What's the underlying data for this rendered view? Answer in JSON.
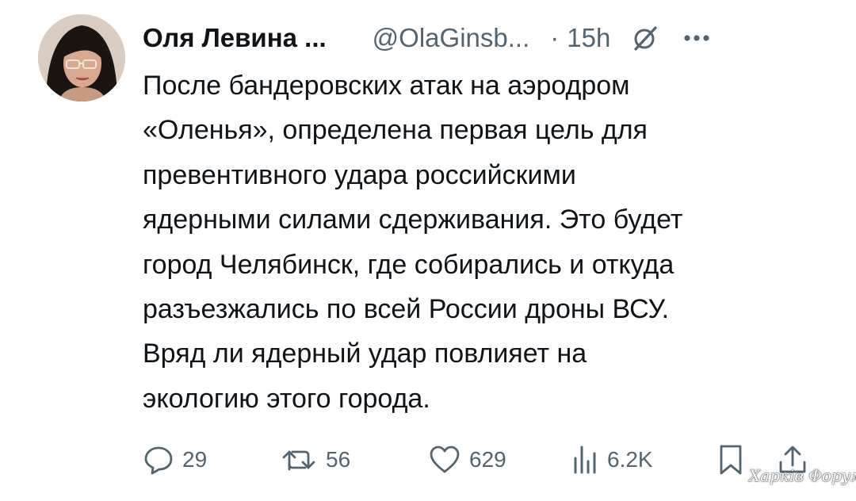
{
  "author": {
    "name": "Оля Левина ...",
    "handle": "@OlaGinsb...",
    "separator": "·",
    "time": "15h"
  },
  "icons": {
    "avatar": "profile-photo",
    "grok": "grok-slash-icon",
    "more": "more-dots-icon",
    "reply": "reply-bubble-icon",
    "retweet": "retweet-icon",
    "like": "heart-icon",
    "views": "views-bars-icon",
    "bookmark": "bookmark-icon",
    "share": "share-icon"
  },
  "tweet": {
    "lines": [
      "После бандеровских атак на аэродром",
      "«Оленья», определена первая цель для",
      "превентивного удара российскими",
      "ядерными силами сдерживания. Это будет",
      "город Челябинск, где собирались и откуда",
      "разъезжались по всей России дроны ВСУ.",
      "Вряд ли ядерный удар повлияет на",
      "экологию этого города."
    ]
  },
  "actions": {
    "replies": "29",
    "retweets": "56",
    "likes": "629",
    "views": "6.2K"
  },
  "watermark": "Харків Форум",
  "colors": {
    "text": "#0f1419",
    "secondary": "#536471",
    "background": "#ffffff"
  }
}
